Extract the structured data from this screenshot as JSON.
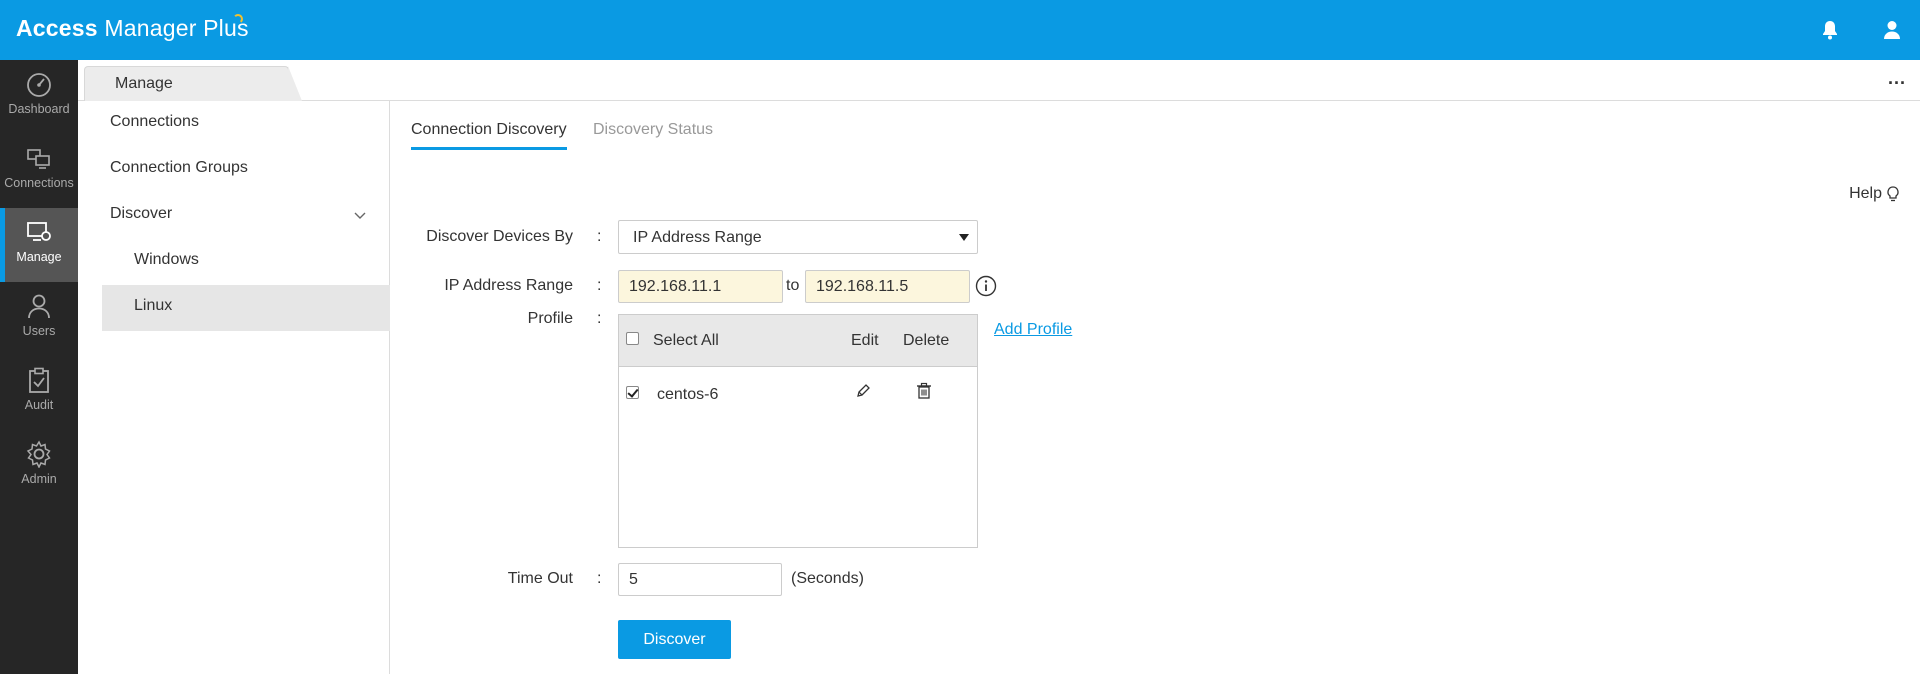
{
  "app": {
    "brand_bold": "Access",
    "brand_light": " Manager Plus",
    "icons": [
      "bell-icon",
      "user-icon"
    ]
  },
  "rail": {
    "items": [
      {
        "label": "Dashboard",
        "icon": "dashboard-icon"
      },
      {
        "label": "Connections",
        "icon": "connections-icon"
      },
      {
        "label": "Manage",
        "icon": "manage-icon",
        "active": true
      },
      {
        "label": "Users",
        "icon": "users-icon"
      },
      {
        "label": "Audit",
        "icon": "audit-icon"
      },
      {
        "label": "Admin",
        "icon": "admin-icon"
      }
    ]
  },
  "tabstrip": {
    "manage_tab": "Manage",
    "more": "..."
  },
  "subnav": {
    "items": [
      {
        "label": "Connections"
      },
      {
        "label": "Connection Groups"
      },
      {
        "label": "Discover",
        "expanded": true
      },
      {
        "label": "Windows"
      },
      {
        "label": "Linux",
        "selected": true
      }
    ]
  },
  "main": {
    "tabs": [
      {
        "label": "Connection Discovery",
        "active": true
      },
      {
        "label": "Discovery Status"
      }
    ],
    "help": "Help",
    "form": {
      "discover_by_label": "Discover Devices By",
      "discover_by_value": "IP Address Range",
      "ip_range_label": "IP Address Range",
      "ip_from": "192.168.11.1",
      "to_label": "to",
      "ip_to": "192.168.11.5",
      "profile_label": "Profile",
      "colon": ":",
      "profile_table": {
        "select_all": "Select All",
        "edit": "Edit",
        "delete": "Delete",
        "rows": [
          {
            "name": "centos-6",
            "checked": true
          }
        ]
      },
      "add_profile": "Add Profile",
      "timeout_label": "Time Out",
      "timeout_value": "5",
      "seconds": "(Seconds)",
      "discover_button": "Discover"
    }
  },
  "colors": {
    "accent": "#0a9ae3",
    "rail_bg": "#262626",
    "ip_field_bg": "#fcf6dd"
  }
}
